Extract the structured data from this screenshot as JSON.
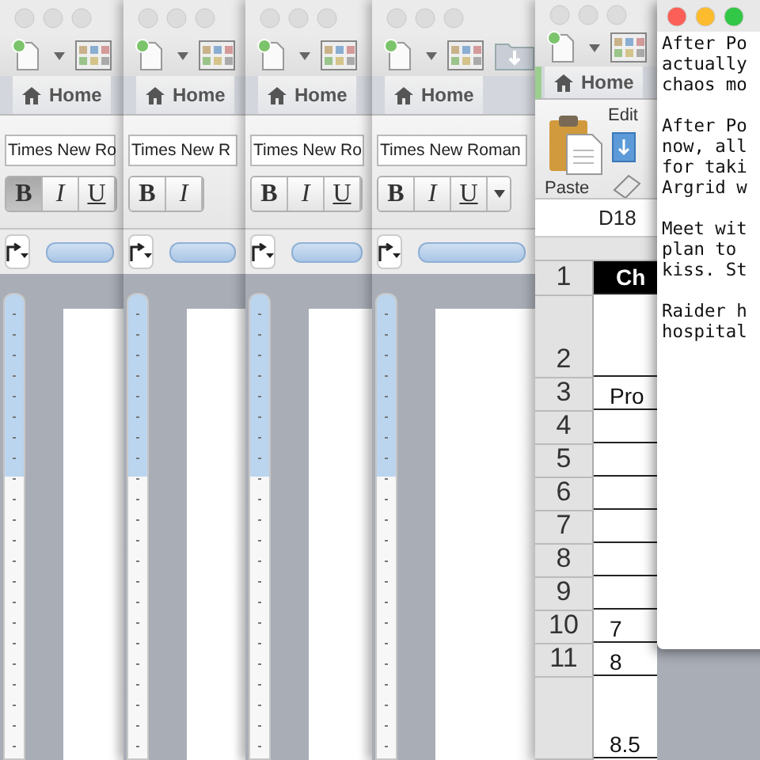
{
  "word_windows": [
    {
      "active": false,
      "tab": "Home",
      "font_field": "Times New Ro",
      "style_buttons": [
        {
          "label": "B",
          "selected": true
        },
        {
          "label": "I",
          "selected": false
        },
        {
          "label": "U",
          "selected": false
        }
      ]
    },
    {
      "active": false,
      "tab": "Home",
      "font_field": "Times New R",
      "style_buttons": [
        {
          "label": "B",
          "selected": false
        },
        {
          "label": "I",
          "selected": false
        }
      ]
    },
    {
      "active": false,
      "tab": "Home",
      "font_field": "Times New Ro",
      "style_buttons": [
        {
          "label": "B",
          "selected": false
        },
        {
          "label": "I",
          "selected": false
        },
        {
          "label": "U",
          "selected": false
        }
      ]
    },
    {
      "active": false,
      "tab": "Home",
      "font_field": "Times New Roman",
      "style_buttons": [
        {
          "label": "B",
          "selected": false
        },
        {
          "label": "I",
          "selected": false
        },
        {
          "label": "U",
          "selected": false
        }
      ]
    }
  ],
  "spreadsheet_window": {
    "active": false,
    "tab": "Home",
    "group_label": "Edit",
    "paste_label": "Paste",
    "cell_reference": "D18",
    "rows": [
      {
        "number": "1",
        "cell": "Ch",
        "kind": "header"
      },
      {
        "number": "2",
        "cell": "",
        "kind": "tall"
      },
      {
        "number": "3",
        "cell": "Pro",
        "kind": "normal"
      },
      {
        "number": "4",
        "cell": "",
        "kind": "normal"
      },
      {
        "number": "5",
        "cell": "",
        "kind": "normal"
      },
      {
        "number": "6",
        "cell": "",
        "kind": "normal"
      },
      {
        "number": "7",
        "cell": "",
        "kind": "normal"
      },
      {
        "number": "8",
        "cell": "",
        "kind": "normal"
      },
      {
        "number": "9",
        "cell": "",
        "kind": "normal"
      },
      {
        "number": "10",
        "cell": "7",
        "kind": "normal"
      },
      {
        "number": "11",
        "cell": "8",
        "kind": "normal"
      },
      {
        "cell": "8.5",
        "kind": "tall"
      }
    ]
  },
  "notes_window": {
    "active": true,
    "paragraphs": [
      "After Po\nactually\nchaos mo",
      "After Po\nnow, all\nfor taki\nArgrid w",
      "Meet wit\nplan to\nkiss. St",
      "Raider h\nhospital"
    ]
  }
}
